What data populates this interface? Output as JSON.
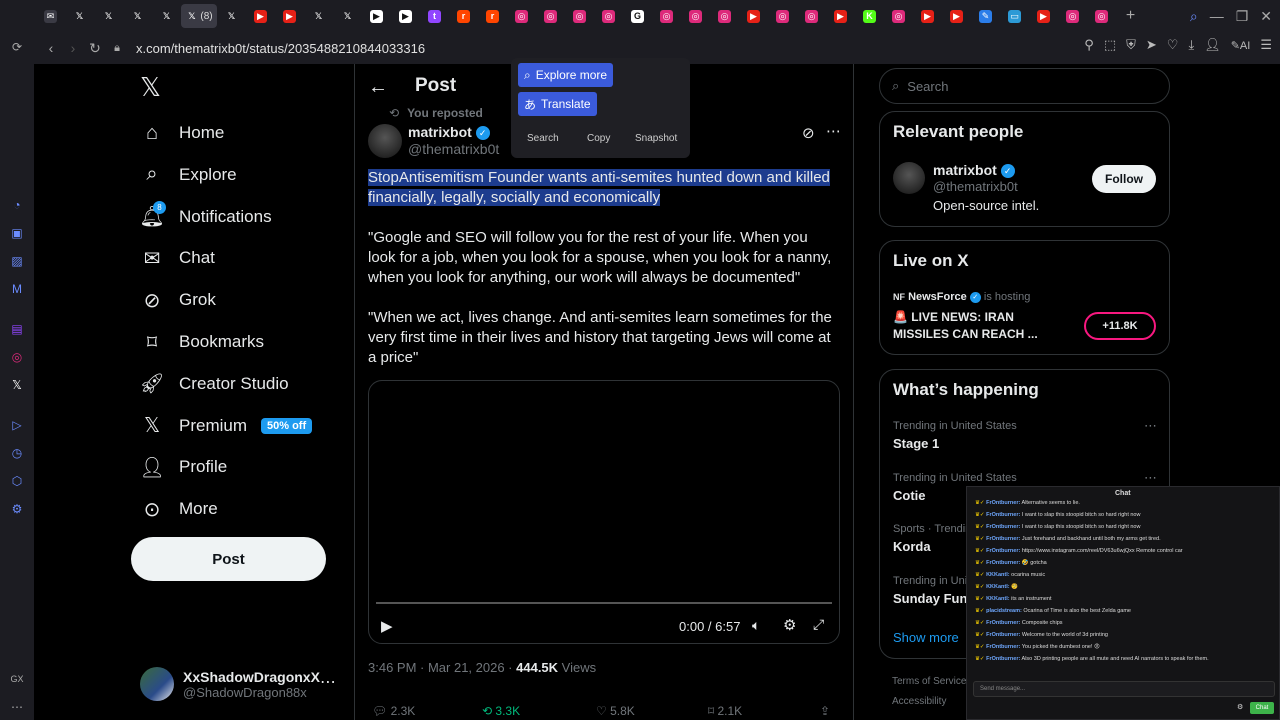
{
  "browser": {
    "url": "x.com/thematrixb0t/status/2035488210844033316",
    "active_tab_count": "(8)"
  },
  "tabs": [
    {
      "icon": "mail-icon",
      "color": "#3a3a44",
      "glyph": "✉"
    },
    {
      "icon": "x-icon",
      "color": "#000000",
      "glyph": "𝕏"
    },
    {
      "icon": "x-icon",
      "color": "#000000",
      "glyph": "𝕏"
    },
    {
      "icon": "x-icon",
      "color": "#000000",
      "glyph": "𝕏"
    },
    {
      "icon": "x-icon",
      "color": "#000000",
      "glyph": "𝕏"
    },
    {
      "icon": "x-icon-active",
      "color": "#000000",
      "glyph": "𝕏",
      "active": true
    },
    {
      "icon": "x-icon",
      "color": "#000000",
      "glyph": "𝕏"
    },
    {
      "icon": "youtube-icon",
      "color": "#e62117",
      "glyph": "▶"
    },
    {
      "icon": "youtube-icon",
      "color": "#e62117",
      "glyph": "▶"
    },
    {
      "icon": "x-icon",
      "color": "#000000",
      "glyph": "𝕏"
    },
    {
      "icon": "x-icon",
      "color": "#000000",
      "glyph": "𝕏"
    },
    {
      "icon": "play-icon",
      "color": "#ffffff",
      "glyph": "▶"
    },
    {
      "icon": "play-icon",
      "color": "#ffffff",
      "glyph": "▶"
    },
    {
      "icon": "twitch-icon",
      "color": "#9146ff",
      "glyph": "t"
    },
    {
      "icon": "reddit-icon",
      "color": "#ff4500",
      "glyph": "r"
    },
    {
      "icon": "reddit-icon",
      "color": "#ff4500",
      "glyph": "r"
    },
    {
      "icon": "instagram-icon",
      "color": "#dd2a7b",
      "glyph": "◎"
    },
    {
      "icon": "instagram-icon",
      "color": "#dd2a7b",
      "glyph": "◎"
    },
    {
      "icon": "instagram-icon",
      "color": "#dd2a7b",
      "glyph": "◎"
    },
    {
      "icon": "instagram-icon",
      "color": "#dd2a7b",
      "glyph": "◎"
    },
    {
      "icon": "google-icon",
      "color": "#ffffff",
      "glyph": "G"
    },
    {
      "icon": "instagram-icon",
      "color": "#dd2a7b",
      "glyph": "◎"
    },
    {
      "icon": "instagram-icon",
      "color": "#dd2a7b",
      "glyph": "◎"
    },
    {
      "icon": "instagram-icon",
      "color": "#dd2a7b",
      "glyph": "◎"
    },
    {
      "icon": "youtube-icon",
      "color": "#e62117",
      "glyph": "▶"
    },
    {
      "icon": "instagram-icon",
      "color": "#dd2a7b",
      "glyph": "◎"
    },
    {
      "icon": "instagram-icon",
      "color": "#dd2a7b",
      "glyph": "◎"
    },
    {
      "icon": "youtube-icon",
      "color": "#e62117",
      "glyph": "▶"
    },
    {
      "icon": "kick-icon",
      "color": "#53fc18",
      "glyph": "K"
    },
    {
      "icon": "instagram-icon",
      "color": "#dd2a7b",
      "glyph": "◎"
    },
    {
      "icon": "youtube-icon",
      "color": "#e62117",
      "glyph": "▶"
    },
    {
      "icon": "youtube-icon",
      "color": "#e62117",
      "glyph": "▶"
    },
    {
      "icon": "edit-icon",
      "color": "#2b7de9",
      "glyph": "✎"
    },
    {
      "icon": "app-icon",
      "color": "#2c9ad6",
      "glyph": "▭"
    },
    {
      "icon": "youtube-icon",
      "color": "#e62117",
      "glyph": "▶"
    },
    {
      "icon": "instagram-icon",
      "color": "#dd2a7b",
      "glyph": "◎"
    },
    {
      "icon": "instagram-icon",
      "color": "#dd2a7b",
      "glyph": "◎"
    }
  ],
  "nav": {
    "items": [
      {
        "label": "Home",
        "icon": "home-icon"
      },
      {
        "label": "Explore",
        "icon": "search-icon"
      },
      {
        "label": "Notifications",
        "icon": "bell-icon",
        "badge": "8"
      },
      {
        "label": "Chat",
        "icon": "mail-icon"
      },
      {
        "label": "Grok",
        "icon": "grok-icon"
      },
      {
        "label": "Bookmarks",
        "icon": "bookmark-icon"
      },
      {
        "label": "Creator Studio",
        "icon": "rocket-icon"
      },
      {
        "label": "Premium",
        "icon": "x-icon",
        "badge": "50% off"
      },
      {
        "label": "Profile",
        "icon": "person-icon"
      },
      {
        "label": "More",
        "icon": "more-circle-icon"
      }
    ],
    "post_button": "Post",
    "account": {
      "name": "XxShadowDragonxX",
      "handle": "@ShadowDragon88x"
    }
  },
  "post": {
    "header_title": "Post",
    "reposted_label": "You reposted",
    "author_name": "matrixbot",
    "author_handle": "@thematrixb0t",
    "selected_text": "StopAntisemitism Founder wants anti-semites hunted down and killed financially, legally, socially and economically",
    "paragraph_1": "\"Google and SEO will follow you for the rest of your life. When you look for a job, when you look for a spouse, when you look for a nanny, when you look for anything, our work will always be documented\"",
    "paragraph_2": "\"When we act, lives change. And anti-semites learn sometimes for the very first time in their lives and history that targeting Jews will come at a price\"",
    "video_time": "0:00 / 6:57",
    "timestamp": "3:46 PM · Mar 21, 2026 · ",
    "views_count": "444.5K",
    "views_label": " Views",
    "stats": {
      "replies": "2.3K",
      "reposts": "3.3K",
      "likes": "5.8K",
      "bookmarks": "2.1K"
    }
  },
  "selection_popup": {
    "explore_more": "Explore more",
    "translate": "Translate",
    "search": "Search",
    "copy": "Copy",
    "snapshot": "Snapshot"
  },
  "sidebar": {
    "search_placeholder": "Search",
    "relevant_title": "Relevant people",
    "relevant_name": "matrixbot",
    "relevant_handle": "@thematrixb0t",
    "relevant_bio": "Open-source intel.",
    "follow_label": "Follow",
    "live_title": "Live on X",
    "live_host": "NewsForce",
    "live_hosting": "is hosting",
    "live_headline_1": "🚨 LIVE NEWS: IRAN",
    "live_headline_2": "MISSILES CAN REACH ...",
    "live_count": "+11.8K",
    "happening_title": "What’s happening",
    "trends": [
      {
        "context": "Trending in United States",
        "name": "Stage 1"
      },
      {
        "context": "Trending in United States",
        "name": "Cotie"
      },
      {
        "context": "Sports · Trending",
        "name": "Korda"
      },
      {
        "context": "Trending in United States",
        "name": "Sunday Funday"
      }
    ],
    "show_more": "Show more",
    "footer_1": "Terms of Service",
    "footer_2": "Accessibility"
  },
  "chat_overlay": {
    "title": "Chat",
    "lines": [
      {
        "user": "FrOntburner:",
        "text": " Alternative seems to lie."
      },
      {
        "user": "FrOntburner:",
        "text": " I want to slap this stoopid bitch so hard right now"
      },
      {
        "user": "FrOntburner:",
        "text": " I want to slap this stoopid bitch so hard right now"
      },
      {
        "user": "FrOntburner:",
        "text": " Just forehand and backhand until both my arms get tired."
      },
      {
        "user": "FrOntburner:",
        "text": " https://www.instagram.com/reel/DV63u6wjQxx Remote control car"
      },
      {
        "user": "FrOntburner:",
        "text": " 🤣 gotcha"
      },
      {
        "user": "KKKantl:",
        "text": " ocarina music"
      },
      {
        "user": "KKKantl:",
        "text": " 🧐"
      },
      {
        "user": "KKKantl:",
        "text": " its an instrument"
      },
      {
        "user": "placidstream:",
        "text": " Ocarina of Time is also the best Zelda game"
      },
      {
        "user": "FrOntburner:",
        "text": " Composite chips"
      },
      {
        "user": "FrOntburner:",
        "text": " Welcome to the world of 3d printing"
      },
      {
        "user": "FrOntburner:",
        "text": " You picked the dumbest one! 😡"
      },
      {
        "user": "FrOntburner:",
        "text": " Also 3D printing people are all mute and need AI narrators to speak for them."
      }
    ],
    "input_placeholder": "Send message...",
    "send_label": "Chat"
  }
}
